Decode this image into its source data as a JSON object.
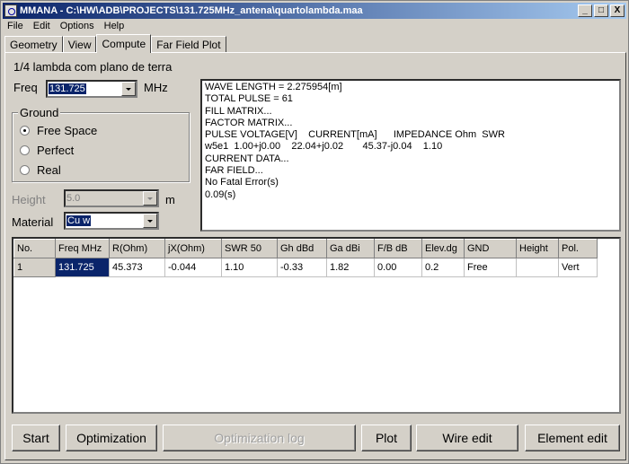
{
  "window": {
    "title": "MMANA - C:\\HW\\ADB\\PROJECTS\\131.725MHz_antena\\quartolambda.maa",
    "minimize": "_",
    "maximize": "□",
    "close": "X"
  },
  "menu": [
    "File",
    "Edit",
    "Options",
    "Help"
  ],
  "tabs": [
    "Geometry",
    "View",
    "Compute",
    "Far Field Plot"
  ],
  "antenna_name": "1/4 lambda com plano de terra",
  "freq": {
    "label": "Freq",
    "value": "131.725",
    "unit": "MHz"
  },
  "ground": {
    "legend": "Ground",
    "options": [
      "Free Space",
      "Perfect",
      "Real"
    ],
    "selected": "Free Space"
  },
  "height": {
    "label": "Height",
    "value": "5.0",
    "unit": "m"
  },
  "material": {
    "label": "Material",
    "value": "Cu w"
  },
  "output_lines": [
    "WAVE LENGTH = 2.275954[m]",
    "TOTAL PULSE = 61",
    "FILL MATRIX...",
    "FACTOR MATRIX...",
    "PULSE VOLTAGE[V]    CURRENT[mA]      IMPEDANCE Ohm  SWR",
    "w5e1  1.00+j0.00    22.04+j0.02       45.37-j0.04    1.10",
    "CURRENT DATA...",
    "FAR FIELD...",
    "No Fatal Error(s)",
    "0.09(s)"
  ],
  "results": {
    "columns": [
      "No.",
      "Freq MHz",
      "R(Ohm)",
      "jX(Ohm)",
      "SWR 50",
      "Gh dBd",
      "Ga dBi",
      "F/B dB",
      "Elev.dg",
      "GND",
      "Height",
      "Pol."
    ],
    "rows": [
      [
        "1",
        "131.725",
        "45.373",
        "-0.044",
        "1.10",
        "-0.33",
        "1.82",
        "0.00",
        "0.2",
        "Free",
        "",
        "Vert"
      ]
    ]
  },
  "buttons": {
    "start": "Start",
    "optimization": "Optimization",
    "optimization_log": "Optimization log",
    "plot": "Plot",
    "wire_edit": "Wire edit",
    "element_edit": "Element edit"
  }
}
